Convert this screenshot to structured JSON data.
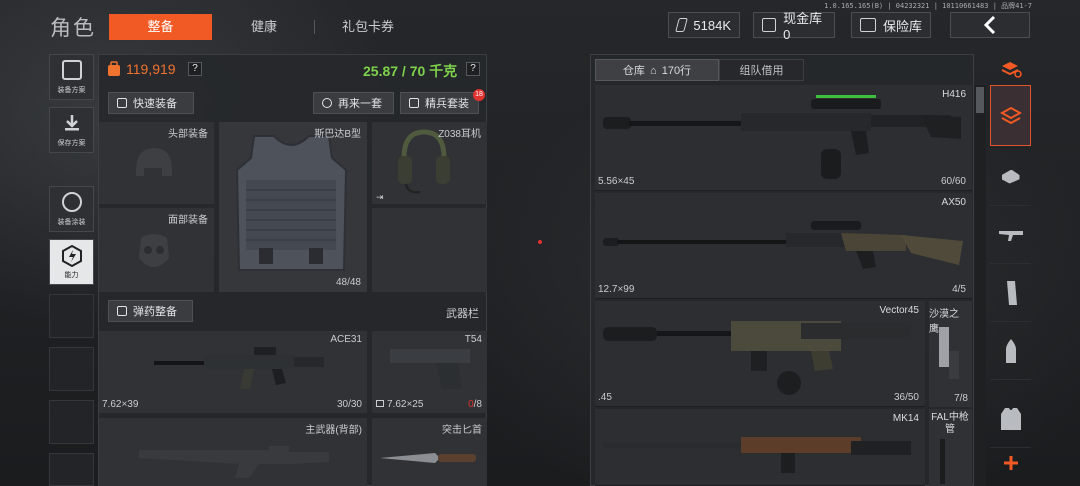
{
  "header": {
    "title": "角色",
    "tabs": [
      {
        "label": "整备",
        "active": true
      },
      {
        "label": "健康",
        "active": false
      },
      {
        "label": "礼包卡券",
        "active": false
      }
    ],
    "version": "1.0.165.165(B) | 04232321 | 10110661483 | 品牌41-7",
    "currency": {
      "value": "5184K",
      "icon": "money-icon"
    },
    "cash_vault": {
      "label": "现金库 0",
      "icon": "vault-icon"
    },
    "safe_box": {
      "label": "保险库",
      "icon": "safe-icon"
    },
    "back_icon": "chevron-left-icon"
  },
  "left_nav": [
    {
      "label": "装备方案",
      "icon": "loadout-icon",
      "active": false
    },
    {
      "label": "保存方案",
      "icon": "save-icon",
      "active": false
    },
    {
      "label": "装备涂装",
      "icon": "paint-icon",
      "active": false
    },
    {
      "label": "能力",
      "icon": "ability-icon",
      "active": true
    }
  ],
  "loadout": {
    "value": "119,919",
    "weight": "25.87 / 70 千克",
    "help": "?",
    "quick_equip": "快速装备",
    "again": "再来一套",
    "elite": "精兵套装",
    "elite_badge": "18",
    "slots": {
      "head": "头部装备",
      "face": "面部装备",
      "armor": "斯巴达B型",
      "armor_durability": "48/48",
      "headset": "Z038耳机",
      "ammo": "弹药整备",
      "weapon_bar": "武器栏",
      "primary": {
        "name": "ACE31",
        "caliber": "7.62×39",
        "ammo": "30/30"
      },
      "pistol": {
        "name": "T54",
        "caliber": "7.62×25",
        "ammo_current": "0",
        "ammo_max": "/8"
      },
      "back_primary": "主武器(背部)",
      "knife": "突击匕首"
    }
  },
  "warehouse": {
    "tab_active": "仓库",
    "rows": "170行",
    "tab_team": "组队借用",
    "items": [
      {
        "name": "H416",
        "caliber": "5.56×45",
        "ammo": "60/60"
      },
      {
        "name": "AX50",
        "caliber": "12.7×99",
        "ammo": "4/5"
      },
      {
        "name": "Vector45",
        "caliber": ".45",
        "ammo": "36/50"
      },
      {
        "name": "MK14",
        "caliber": "",
        "ammo": ""
      }
    ],
    "side_items": [
      {
        "name": "沙漠之鹰",
        "ammo": "7/8"
      },
      {
        "name": "FAL中枪管",
        "ammo": ""
      }
    ]
  },
  "right_rail": [
    {
      "icon": "stack-refresh-icon"
    },
    {
      "icon": "all-items-icon"
    },
    {
      "icon": "helmet-icon"
    },
    {
      "icon": "rifle-icon"
    },
    {
      "icon": "magazine-icon"
    },
    {
      "icon": "bullet-icon"
    },
    {
      "icon": "vest-icon"
    },
    {
      "icon": "plus-icon"
    }
  ],
  "colors": {
    "accent": "#f15a24",
    "value": "#f0732f",
    "weight": "#7ed24b",
    "warn": "#e0322f"
  }
}
